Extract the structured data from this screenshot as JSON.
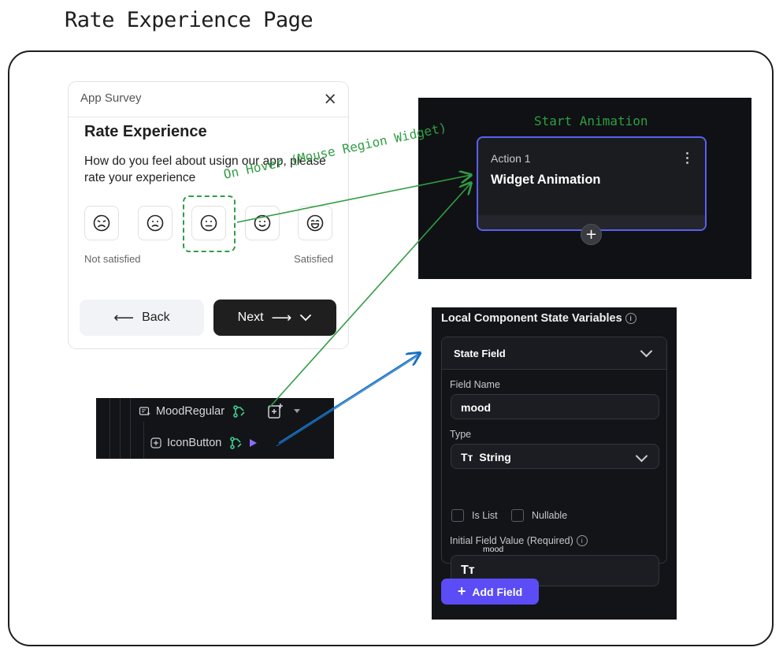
{
  "page_title": "Rate Experience Page",
  "survey": {
    "header_title": "App Survey",
    "close_glyph": "×",
    "title": "Rate Experience",
    "description": "How do you feel about usign our app, please rate your experience",
    "moods": [
      {
        "name": "very-sad",
        "icon": "frown-face-icon"
      },
      {
        "name": "sad",
        "icon": "slight-frown-face-icon"
      },
      {
        "name": "neutral",
        "icon": "neutral-face-icon"
      },
      {
        "name": "happy",
        "icon": "smile-face-icon"
      },
      {
        "name": "very-happy",
        "icon": "grin-face-icon"
      }
    ],
    "scale_min_label": "Not satisfied",
    "scale_max_label": "Satisfied",
    "back_label": "Back",
    "next_label": "Next",
    "back_arrow": "⟵",
    "next_arrow": "⟶"
  },
  "annotations": {
    "on_hover": "On Hover (Mouse Region Widget)",
    "start_animation": "Start Animation"
  },
  "action_panel": {
    "action_label": "Action 1",
    "action_name": "Widget Animation",
    "plus_glyph": "+"
  },
  "widget_tree": {
    "rows": [
      {
        "label": "MoodRegular"
      },
      {
        "label": "IconButton"
      }
    ]
  },
  "state_panel": {
    "title": "Local Component State Variables",
    "section_label": "State Field",
    "field_name_label": "Field Name",
    "field_name_value": "mood",
    "type_label": "Type",
    "type_value": "String",
    "is_list_label": "Is List",
    "nullable_label": "Nullable",
    "initial_value_label": "Initial Field Value (Required)",
    "initial_value_hint": "mood",
    "add_field_label": "Add Field",
    "info_glyph": "i",
    "type_glyph": "Tт"
  },
  "colors": {
    "annotation_green": "#2f9e44",
    "arrow_blue": "#1971c2",
    "accent_purple": "#5b4cf6",
    "action_border": "#5b5ff4"
  }
}
